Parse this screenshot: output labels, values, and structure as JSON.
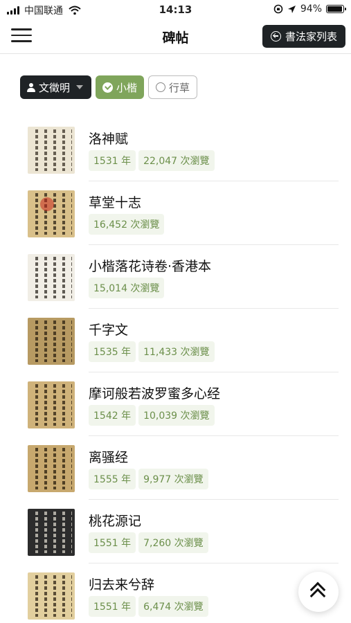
{
  "status_bar": {
    "carrier": "中国联通",
    "time": "14:13",
    "battery": "94%",
    "battery_level": 0.94,
    "icons": [
      "signal-icon",
      "wifi-icon",
      "orientation-lock-icon",
      "location-icon",
      "battery-icon"
    ]
  },
  "header": {
    "title": "碑帖",
    "calligraphers_button": "書法家列表",
    "icons": [
      "menu-icon",
      "circle-arrow-left-icon"
    ]
  },
  "filters": {
    "author": "文徵明",
    "style_selected": "小楷",
    "style_other": "行草",
    "icons": [
      "person-icon",
      "caret-down-icon",
      "check-circle-icon",
      "empty-circle-icon"
    ]
  },
  "works": [
    {
      "title": "洛神赋",
      "year": "1531 年",
      "views": "22,047 次瀏覽"
    },
    {
      "title": "草堂十志",
      "year": "",
      "views": "16,452 次瀏覽"
    },
    {
      "title": "小楷落花诗卷·香港本",
      "year": "",
      "views": "15,014 次瀏覽"
    },
    {
      "title": "千字文",
      "year": "1535 年",
      "views": "11,433 次瀏覽"
    },
    {
      "title": "摩诃般若波罗蜜多心经",
      "year": "1542 年",
      "views": "10,039 次瀏覽"
    },
    {
      "title": "离骚经",
      "year": "1555 年",
      "views": "9,977 次瀏覽"
    },
    {
      "title": "桃花源记",
      "year": "1551 年",
      "views": "7,260 次瀏覽"
    },
    {
      "title": "归去来兮辞",
      "year": "1551 年",
      "views": "6,474 次瀏覽"
    }
  ],
  "thumb_colors": [
    {
      "bg": "#ece5d3",
      "ink": "#3a3226"
    },
    {
      "bg": "#d9c08a",
      "ink": "#2b2114"
    },
    {
      "bg": "#f1eee6",
      "ink": "#2f2a24"
    },
    {
      "bg": "#b79a62",
      "ink": "#2a1f10"
    },
    {
      "bg": "#cfb27a",
      "ink": "#2a1e0e"
    },
    {
      "bg": "#c7a86e",
      "ink": "#271c0c"
    },
    {
      "bg": "#2c2c2c",
      "ink": "#d8d4c8"
    },
    {
      "bg": "#e2cf9e",
      "ink": "#2c2213"
    }
  ],
  "accent_colors": {
    "dark": "#1f2326",
    "green": "#7fa55b",
    "tag_bg": "#f1f5ec",
    "tag_text": "#6b8f4a"
  },
  "floating": {
    "icon": "double-chevron-up-icon"
  }
}
